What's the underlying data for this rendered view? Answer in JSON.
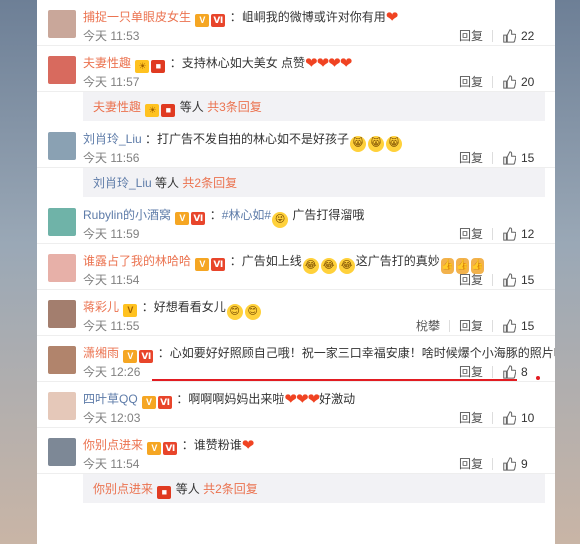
{
  "comments": [
    {
      "user": "捕捉一只单眼皮女生",
      "text": "：岨峒我的微博或许对你有用",
      "time": "今天 11:53",
      "reply_label": "回复",
      "likes": "22",
      "name_color": "orange",
      "badges": [
        "v",
        "vip"
      ],
      "hearts": "❤",
      "avatar_color": "#c9a79a"
    },
    {
      "user": "夫妻性趣",
      "text": "：支持林心如大美女 点赞",
      "time": "今天 11:57",
      "reply_label": "回复",
      "likes": "20",
      "name_color": "orange",
      "badges": [
        "sun",
        "gift"
      ],
      "hearts": "❤❤❤❤",
      "avatar_color": "#d86a5e",
      "sub": {
        "user": "夫妻性趣",
        "mid": "等人",
        "more": "共3条回复",
        "badges": [
          "sun",
          "gift"
        ],
        "name_color": "orange"
      }
    },
    {
      "user": "刘肖玲_Liu",
      "text": "：打广告不发自拍的林心如不是好孩子",
      "time": "今天 11:56",
      "reply_label": "回复",
      "likes": "15",
      "name_color": "blue",
      "badges": [],
      "emo": [
        "😸",
        "😸",
        "😸"
      ],
      "avatar_color": "#8aa1b3",
      "sub": {
        "user": "刘肖玲_Liu",
        "mid": "等人",
        "more": "共2条回复",
        "badges": [],
        "name_color": "blue"
      }
    },
    {
      "user": "Rubylin的小酒窝",
      "text": "：",
      "tag": "#林心如#",
      "text2": " 广告打得溜哦",
      "time": "今天 11:59",
      "reply_label": "回复",
      "likes": "12",
      "name_color": "blue",
      "badges": [
        "v",
        "vip"
      ],
      "emo": [
        "😜"
      ],
      "avatar_color": "#6fb3a8"
    },
    {
      "user": "谁露占了我的林哈哈",
      "text": "：广告如上线",
      "text2": "这广告打的真妙",
      "time": "今天 11:54",
      "reply_label": "回复",
      "likes": "15",
      "name_color": "orange",
      "badges": [
        "v",
        "vip"
      ],
      "emo": [
        "😂",
        "😂",
        "😂"
      ],
      "thumbs": [
        "👍",
        "👍",
        "👍"
      ],
      "avatar_color": "#e7b0a8"
    },
    {
      "user": "蒋彩儿",
      "text": "：好想看看女儿",
      "time": "今天 11:55",
      "reply_label": "回复",
      "likes": "15",
      "name_color": "orange",
      "extra": "梲攀",
      "badges": [
        "vgold"
      ],
      "emo": [
        "😊",
        "😊"
      ],
      "avatar_color": "#a37e6e"
    },
    {
      "user": "潇缃雨",
      "text": "：心如要好好照顾自己哦！祝一家三口幸福安康！啥时候爆个小海豚的照片啦",
      "time": "今天 12:26",
      "reply_label": "回复",
      "likes": "8",
      "name_color": "orange",
      "badges": [
        "v",
        "vip"
      ],
      "avatar_color": "#b1846c"
    },
    {
      "user": "四叶草QQ",
      "text": "：啊啊啊妈妈出来啦",
      "text2": "好激动",
      "time": "今天 12:03",
      "reply_label": "回复",
      "likes": "10",
      "name_color": "blue",
      "badges": [
        "v",
        "vip"
      ],
      "hearts": "❤❤❤",
      "avatar_color": "#e5c8b9"
    },
    {
      "user": "你别点进来",
      "text": "：谁赞粉谁",
      "time": "今天 11:54",
      "reply_label": "回复",
      "likes": "9",
      "name_color": "orange",
      "badges": [
        "v",
        "vip"
      ],
      "hearts": "❤",
      "avatar_color": "#7d8896",
      "sub": {
        "user": "你别点进来",
        "mid": "等人",
        "more": "共2条回复",
        "badges": [
          "gift"
        ],
        "name_color": "orange"
      }
    }
  ],
  "icons": {
    "like": "thumbs-up-icon",
    "heart": "heart-emoji"
  },
  "colors": {
    "accent_orange": "#eb7350",
    "link_blue": "#5d7ba8",
    "highlight_red": "#e21c22"
  }
}
